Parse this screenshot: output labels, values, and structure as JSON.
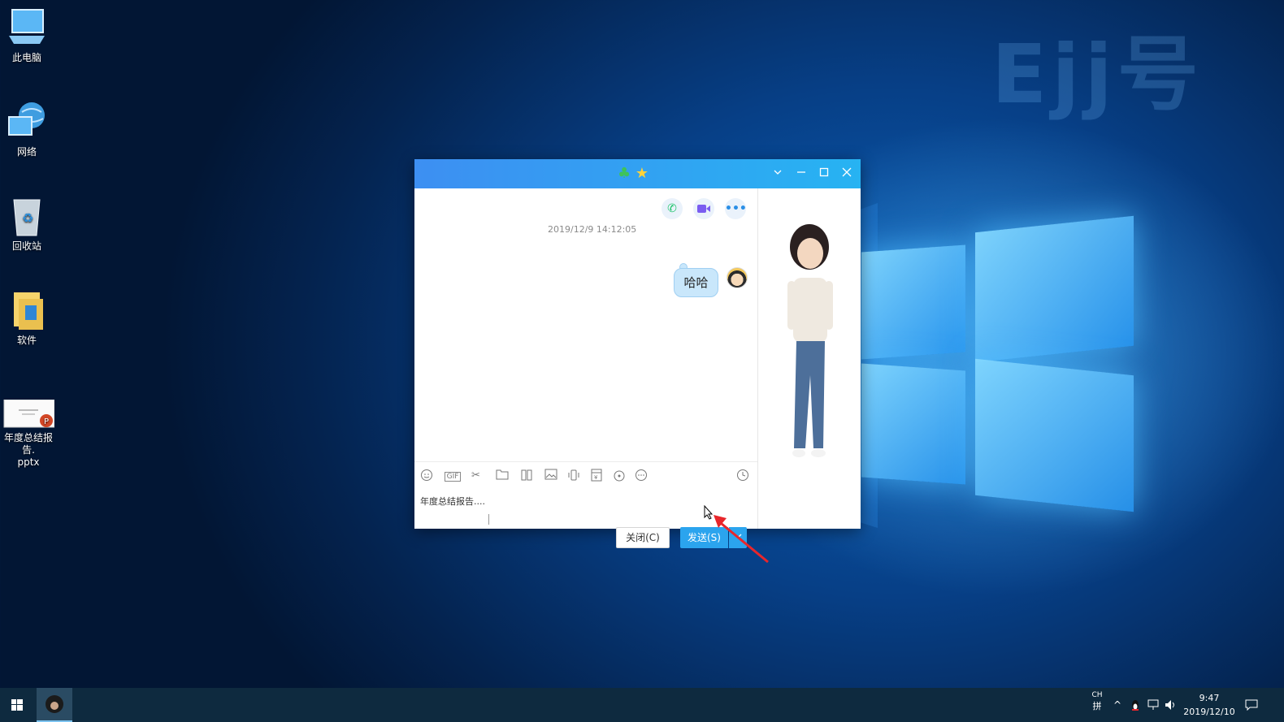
{
  "desktop": {
    "icons": [
      {
        "label": "此电脑",
        "icon": "this-pc-icon"
      },
      {
        "label": "网络",
        "icon": "network-icon"
      },
      {
        "label": "回收站",
        "icon": "recycle-bin-icon"
      },
      {
        "label": "软件",
        "icon": "folder-icon"
      },
      {
        "label": "年度总结报告.\npptx",
        "label_line1": "年度总结报告.",
        "label_line2": "pptx",
        "icon": "pptx-file-icon"
      }
    ],
    "watermark": "Ejj号"
  },
  "chat_window": {
    "title_icons": [
      "clover-icon",
      "star-icon"
    ],
    "window_buttons": [
      "chevron-down-icon",
      "minimize-icon",
      "maximize-icon",
      "close-icon"
    ],
    "header_actions": [
      "phone-call-icon",
      "video-call-icon",
      "more-icon"
    ],
    "timestamp": "2019/12/9 14:12:05",
    "messages": [
      {
        "text": "哈哈",
        "sender": "self"
      }
    ],
    "toolbar_icons": [
      "emoji-icon",
      "gif-icon",
      "screenshot-scissors-icon",
      "folder-icon",
      "file-transfer-icon",
      "image-icon",
      "shake-icon",
      "red-packet-icon",
      "music-icon",
      "more-icon"
    ],
    "gif_label": "GIF",
    "input_text": "年度总结报告....",
    "close_label": "关闭(C)",
    "send_label": "发送(S)",
    "history_icon": "clock-icon"
  },
  "taskbar": {
    "lang_top": "CH",
    "lang_bottom": "拼",
    "time": "9:47",
    "date": "2019/12/10"
  },
  "colors": {
    "title_gradient_start": "#3d8ff2",
    "title_gradient_end": "#27b3f2",
    "send_button": "#2ba4ee",
    "taskbar": "#0e2a3f"
  }
}
